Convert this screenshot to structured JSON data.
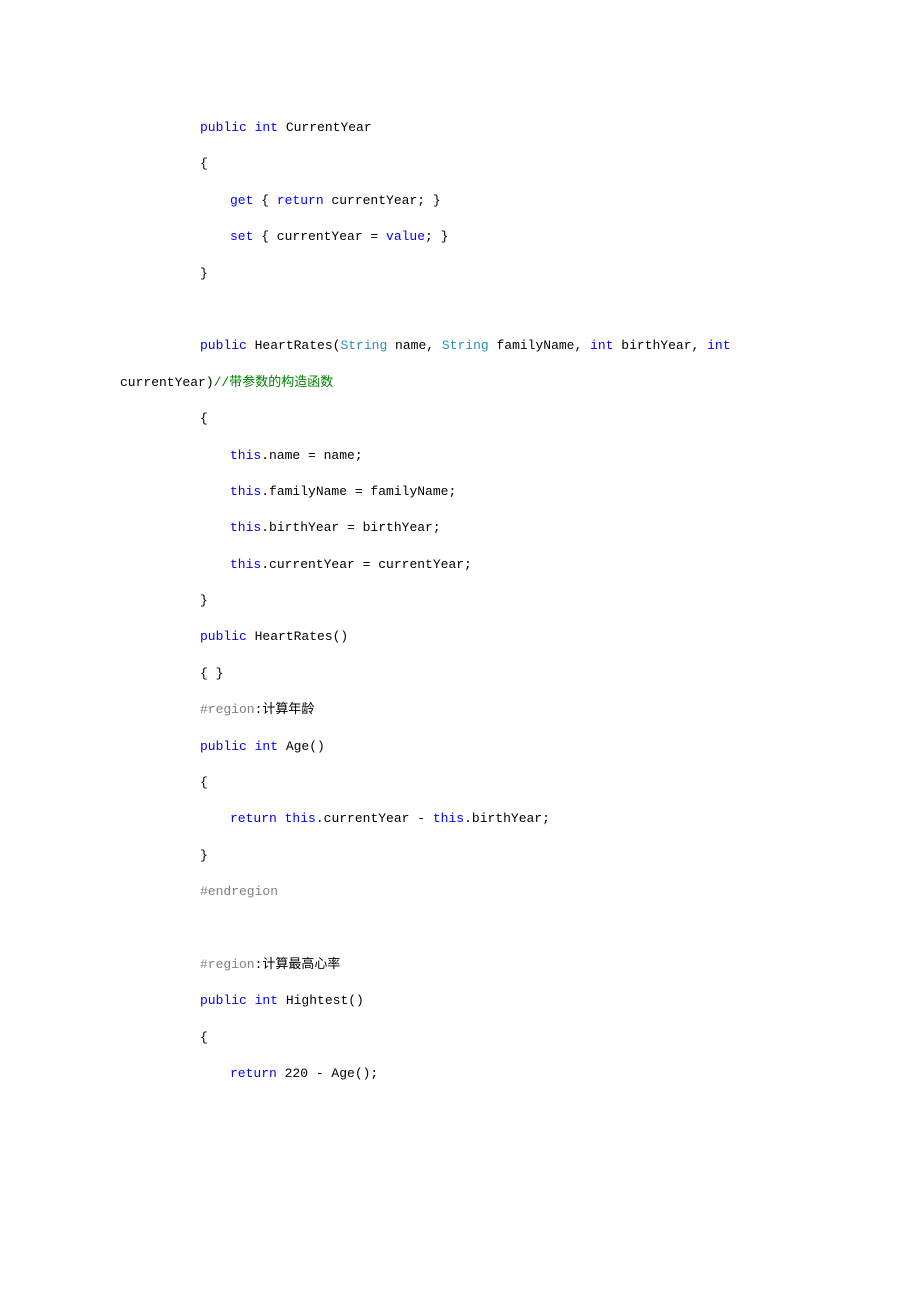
{
  "code": {
    "lines": [
      {
        "cls": "indent1",
        "spans": [
          {
            "c": "kw",
            "t": "public"
          },
          {
            "c": "txt",
            "t": " "
          },
          {
            "c": "kw",
            "t": "int"
          },
          {
            "c": "txt",
            "t": " CurrentYear"
          }
        ]
      },
      {
        "cls": "indent1",
        "spans": [
          {
            "c": "txt",
            "t": "{"
          }
        ]
      },
      {
        "cls": "indent2",
        "spans": [
          {
            "c": "kw",
            "t": "get"
          },
          {
            "c": "txt",
            "t": " { "
          },
          {
            "c": "kw",
            "t": "return"
          },
          {
            "c": "txt",
            "t": " currentYear; }"
          }
        ]
      },
      {
        "cls": "indent2",
        "spans": [
          {
            "c": "kw",
            "t": "set"
          },
          {
            "c": "txt",
            "t": " { currentYear = "
          },
          {
            "c": "kw",
            "t": "value"
          },
          {
            "c": "txt",
            "t": "; }"
          }
        ]
      },
      {
        "cls": "indent1",
        "spans": [
          {
            "c": "txt",
            "t": "}"
          }
        ]
      },
      {
        "cls": "blank",
        "spans": []
      },
      {
        "cls": "indent1",
        "spans": [
          {
            "c": "kw",
            "t": "public"
          },
          {
            "c": "txt",
            "t": " HeartRates("
          },
          {
            "c": "type",
            "t": "String"
          },
          {
            "c": "txt",
            "t": " name, "
          },
          {
            "c": "type",
            "t": "String"
          },
          {
            "c": "txt",
            "t": " familyName, "
          },
          {
            "c": "kw",
            "t": "int"
          },
          {
            "c": "txt",
            "t": " birthYear, "
          },
          {
            "c": "kw",
            "t": "int"
          },
          {
            "c": "txt",
            "t": " "
          }
        ]
      },
      {
        "cls": "wrapped",
        "spans": [
          {
            "c": "txt",
            "t": "currentYear)"
          },
          {
            "c": "comment",
            "t": "//带参数的构造函数"
          }
        ]
      },
      {
        "cls": "indent1",
        "spans": [
          {
            "c": "txt",
            "t": "{"
          }
        ]
      },
      {
        "cls": "indent2",
        "spans": [
          {
            "c": "kw",
            "t": "this"
          },
          {
            "c": "txt",
            "t": ".name = name;"
          }
        ]
      },
      {
        "cls": "indent2",
        "spans": [
          {
            "c": "kw",
            "t": "this"
          },
          {
            "c": "txt",
            "t": ".familyName = familyName;"
          }
        ]
      },
      {
        "cls": "indent2",
        "spans": [
          {
            "c": "kw",
            "t": "this"
          },
          {
            "c": "txt",
            "t": ".birthYear = birthYear;"
          }
        ]
      },
      {
        "cls": "indent2",
        "spans": [
          {
            "c": "kw",
            "t": "this"
          },
          {
            "c": "txt",
            "t": ".currentYear = currentYear;"
          }
        ]
      },
      {
        "cls": "indent1",
        "spans": [
          {
            "c": "txt",
            "t": "}"
          }
        ]
      },
      {
        "cls": "indent1",
        "spans": [
          {
            "c": "kw",
            "t": "public"
          },
          {
            "c": "txt",
            "t": " HeartRates()"
          }
        ]
      },
      {
        "cls": "indent1",
        "spans": [
          {
            "c": "txt",
            "t": "{ }"
          }
        ]
      },
      {
        "cls": "indent1",
        "spans": [
          {
            "c": "pp",
            "t": "#region"
          },
          {
            "c": "txt",
            "t": ":计算年龄"
          }
        ]
      },
      {
        "cls": "indent1",
        "spans": [
          {
            "c": "kw",
            "t": "public"
          },
          {
            "c": "txt",
            "t": " "
          },
          {
            "c": "kw",
            "t": "int"
          },
          {
            "c": "txt",
            "t": " Age()"
          }
        ]
      },
      {
        "cls": "indent1",
        "spans": [
          {
            "c": "txt",
            "t": "{"
          }
        ]
      },
      {
        "cls": "indent2",
        "spans": [
          {
            "c": "kw",
            "t": "return"
          },
          {
            "c": "txt",
            "t": " "
          },
          {
            "c": "kw",
            "t": "this"
          },
          {
            "c": "txt",
            "t": ".currentYear - "
          },
          {
            "c": "kw",
            "t": "this"
          },
          {
            "c": "txt",
            "t": ".birthYear;"
          }
        ]
      },
      {
        "cls": "indent1",
        "spans": [
          {
            "c": "txt",
            "t": "}"
          }
        ]
      },
      {
        "cls": "indent1",
        "spans": [
          {
            "c": "pp",
            "t": "#endregion"
          }
        ]
      },
      {
        "cls": "blank",
        "spans": []
      },
      {
        "cls": "indent1",
        "spans": [
          {
            "c": "pp",
            "t": "#region"
          },
          {
            "c": "txt",
            "t": ":计算最高心率"
          }
        ]
      },
      {
        "cls": "indent1",
        "spans": [
          {
            "c": "kw",
            "t": "public"
          },
          {
            "c": "txt",
            "t": " "
          },
          {
            "c": "kw",
            "t": "int"
          },
          {
            "c": "txt",
            "t": " Hightest()"
          }
        ]
      },
      {
        "cls": "indent1",
        "spans": [
          {
            "c": "txt",
            "t": "{"
          }
        ]
      },
      {
        "cls": "indent2",
        "spans": [
          {
            "c": "kw",
            "t": "return"
          },
          {
            "c": "txt",
            "t": " 220 - Age();"
          }
        ]
      }
    ]
  }
}
